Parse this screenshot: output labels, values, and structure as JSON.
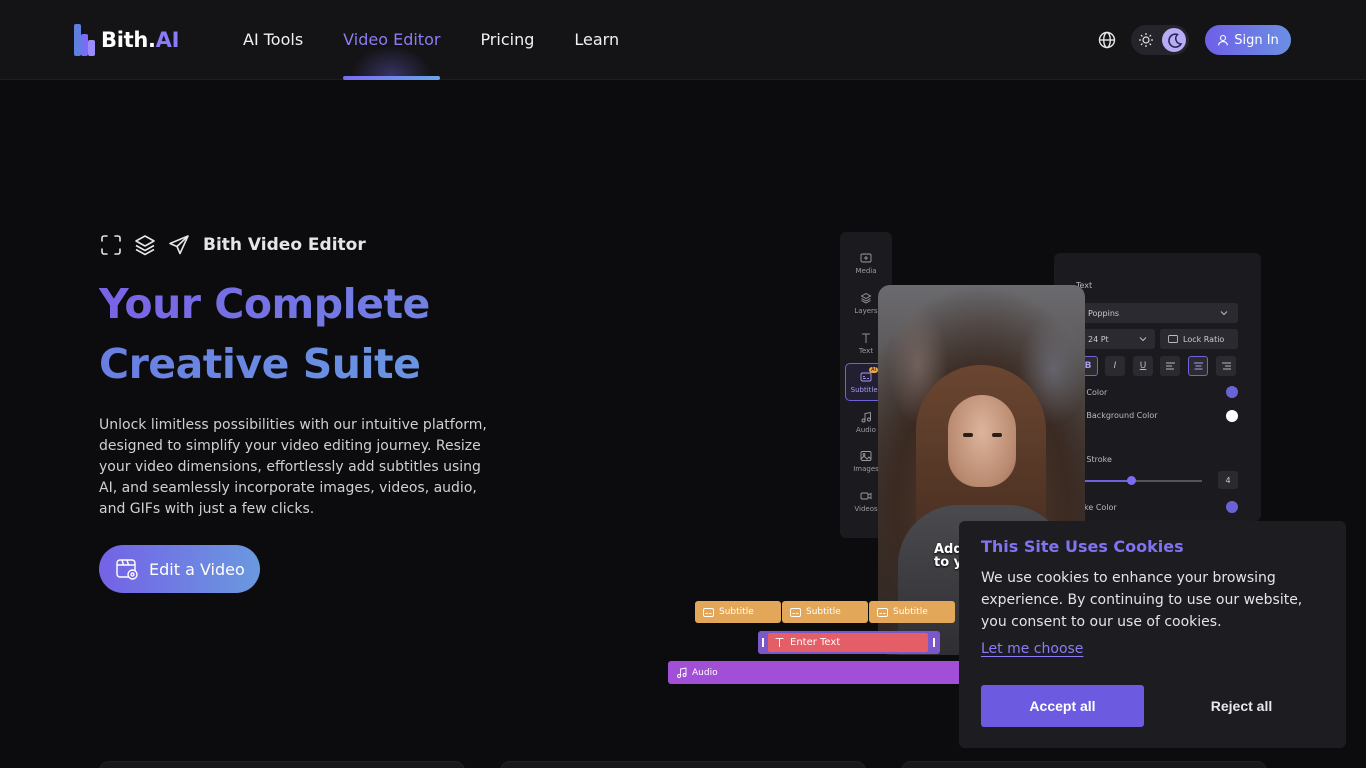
{
  "brand": {
    "name": "Bith.",
    "suffix": "AI"
  },
  "nav": {
    "items": [
      {
        "label": "AI Tools",
        "active": false
      },
      {
        "label": "Video Editor",
        "active": true
      },
      {
        "label": "Pricing",
        "active": false
      },
      {
        "label": "Learn",
        "active": false
      }
    ]
  },
  "header": {
    "sign_in_label": "Sign In",
    "language_icon": "globe-icon",
    "theme": "dark"
  },
  "hero": {
    "eyebrow": "Bith Video Editor",
    "title_line1": "Your Complete",
    "title_line2": "Creative Suite",
    "description": "Unlock limitless possibilities with our intuitive platform, designed to simplify your video editing journey. Resize your video dimensions, effortlessly add subtitles using AI, and seamlessly incorporate images, videos, audio, and GIFs with just a few clicks.",
    "cta_label": "Edit a Video"
  },
  "editor": {
    "tools": [
      {
        "label": "Media",
        "icon": "media-icon"
      },
      {
        "label": "Layers",
        "icon": "layers-icon"
      },
      {
        "label": "Text",
        "icon": "text-icon"
      },
      {
        "label": "Subtitles",
        "icon": "subtitles-icon",
        "badge": "AI",
        "active": true
      },
      {
        "label": "Audio",
        "icon": "music-icon"
      },
      {
        "label": "Images",
        "icon": "image-icon"
      },
      {
        "label": "Videos",
        "icon": "video-icon"
      }
    ],
    "caption_line1": "Add",
    "caption_line2": "to y",
    "properties": {
      "section": "Text",
      "font": "Poppins",
      "size": "24 Pt",
      "lock_ratio": "Lock Ratio",
      "format_buttons": [
        "B",
        "I",
        "U"
      ],
      "text_color_label": "xt Color",
      "text_bg_color_label": "xt Background Color",
      "text_stroke_label": "xt Stroke",
      "stroke_value": "4",
      "stroke_color_label": "roke Color",
      "text_color": "#6a63d6",
      "bg_color": "#ffffff",
      "stroke_color": "#6a63d6"
    },
    "timeline": {
      "subtitle_clips": [
        "Subtitle",
        "Subtitle",
        "Subtitle"
      ],
      "text_clip": "Enter Text",
      "audio_clip": "Audio"
    }
  },
  "cookie": {
    "title": "This Site Uses Cookies",
    "text": "We use cookies to enhance your browsing experience. By continuing to use our website, you consent to our use of cookies.",
    "link": "Let me choose",
    "accept": "Accept all",
    "reject": "Reject all"
  },
  "colors": {
    "accent": "#7b6cf6",
    "background": "#0c0c0e",
    "header": "#141416"
  }
}
